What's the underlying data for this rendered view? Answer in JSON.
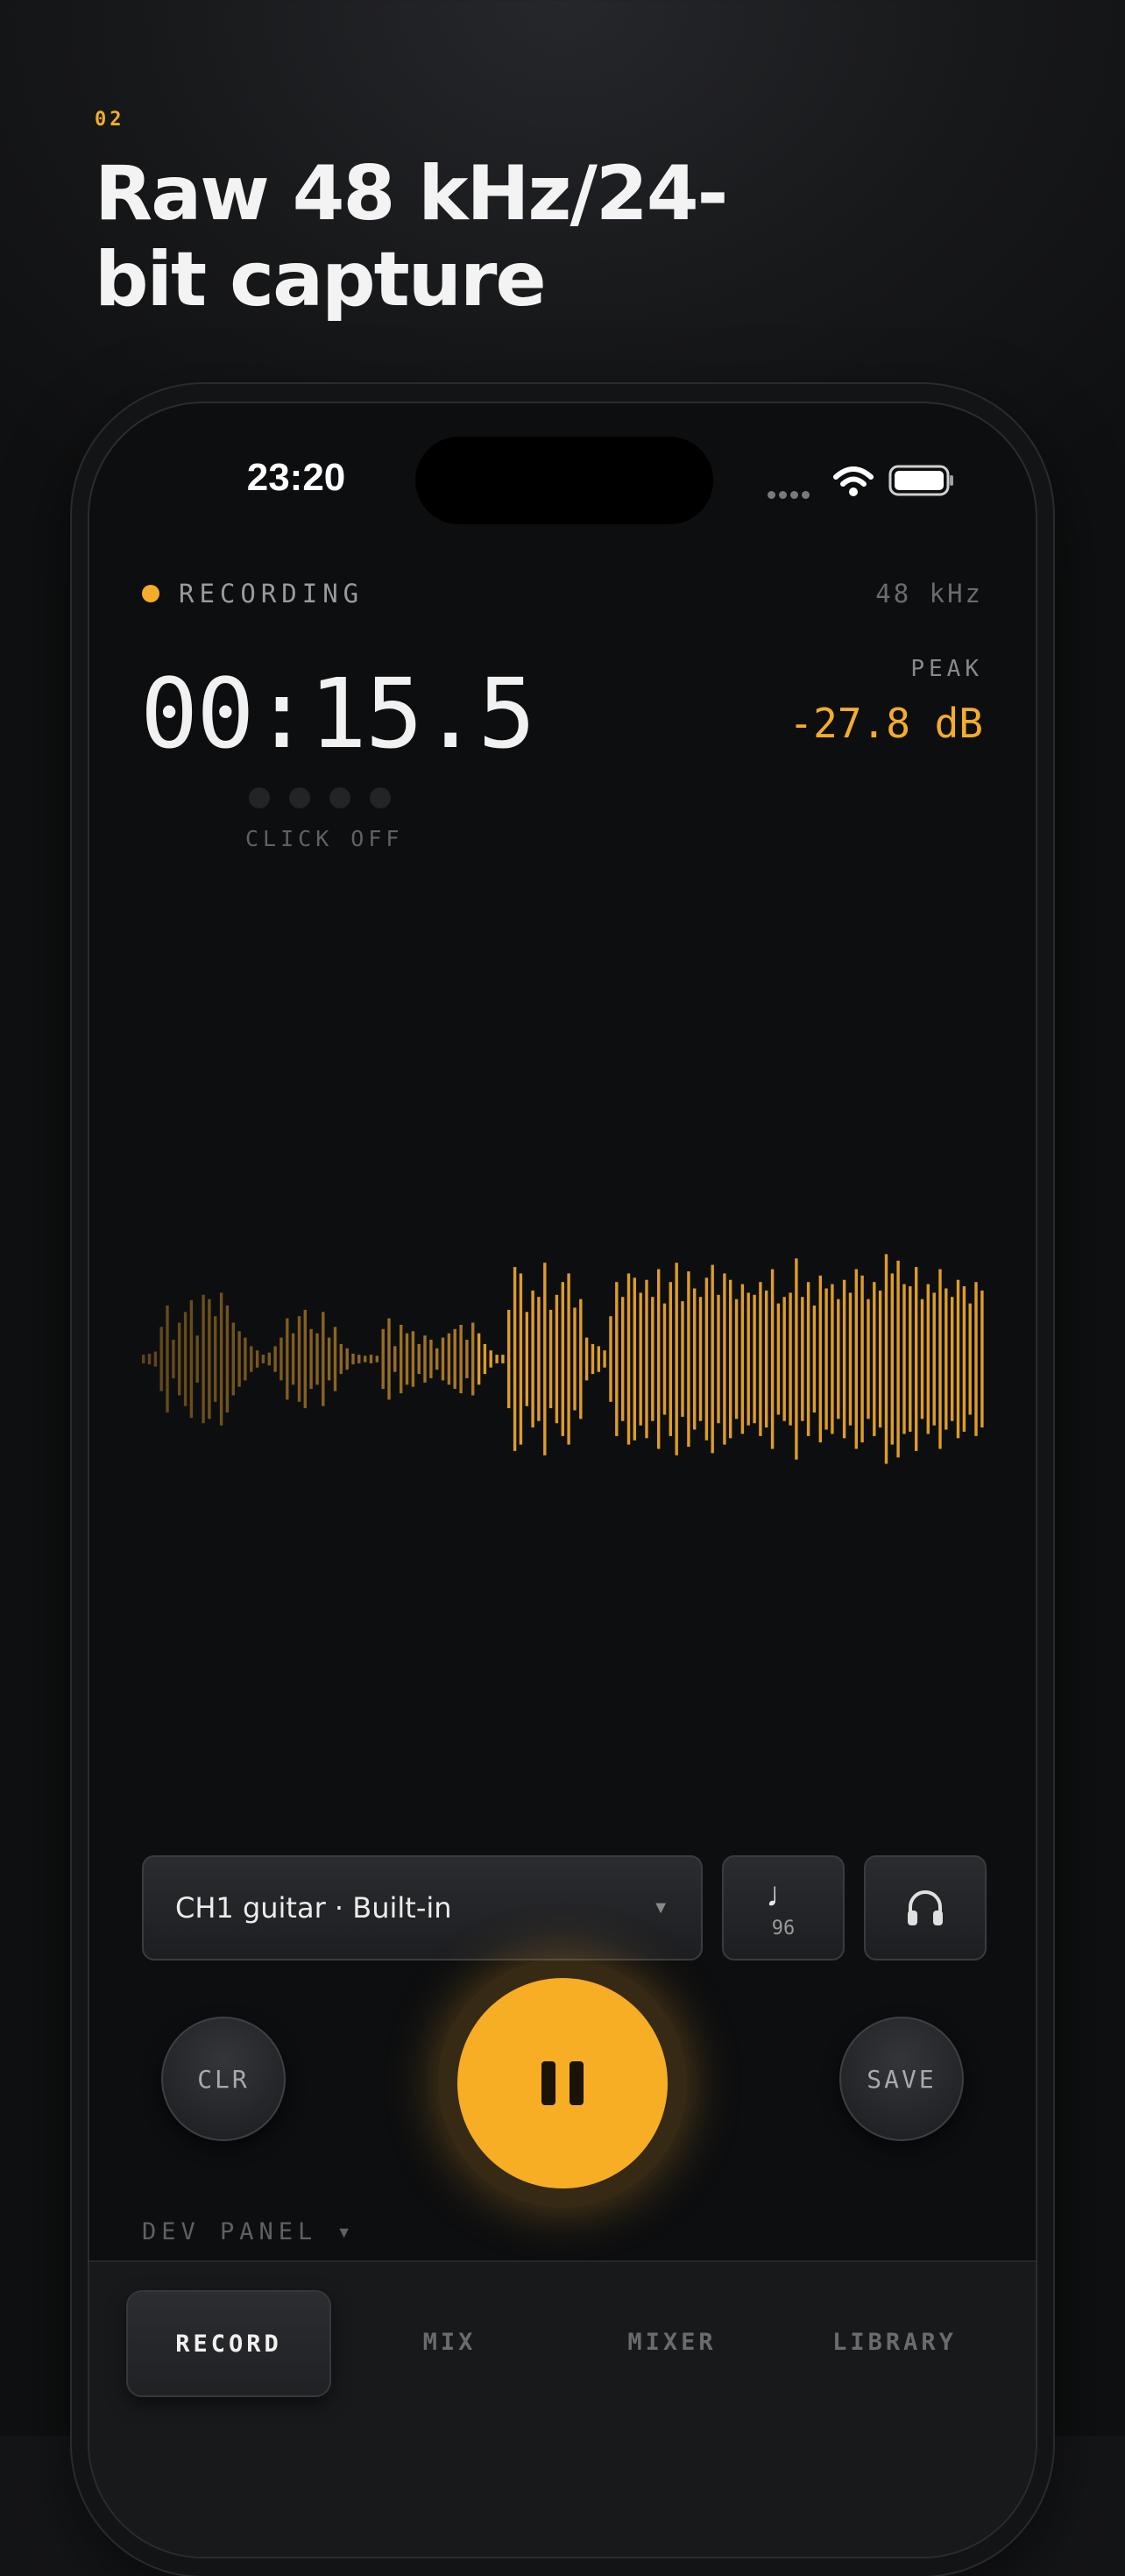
{
  "header": {
    "step": "02",
    "title": "Raw 48 kHz/24-bit capture"
  },
  "status_bar": {
    "time": "23:20"
  },
  "recorder": {
    "state_label": "RECORDING",
    "sample_rate": "48 kHz",
    "elapsed": "00:15.5",
    "peak_label": "PEAK",
    "peak_value": "-27.8 dB",
    "click_label": "CLICK OFF",
    "accent_color": "#f4ad2a",
    "waveform_levels": [
      0.04,
      0.05,
      0.07,
      0.3,
      0.5,
      0.18,
      0.34,
      0.44,
      0.55,
      0.22,
      0.6,
      0.56,
      0.4,
      0.62,
      0.5,
      0.34,
      0.26,
      0.2,
      0.12,
      0.08,
      0.04,
      0.06,
      0.12,
      0.2,
      0.38,
      0.24,
      0.4,
      0.46,
      0.28,
      0.24,
      0.44,
      0.2,
      0.3,
      0.14,
      0.1,
      0.05,
      0.04,
      0.03,
      0.04,
      0.03,
      0.28,
      0.38,
      0.12,
      0.32,
      0.24,
      0.26,
      0.14,
      0.22,
      0.18,
      0.1,
      0.2,
      0.24,
      0.28,
      0.32,
      0.18,
      0.34,
      0.24,
      0.14,
      0.08,
      0.04,
      0.04,
      0.46,
      0.86,
      0.8,
      0.44,
      0.64,
      0.58,
      0.9,
      0.46,
      0.6,
      0.72,
      0.8,
      0.48,
      0.56,
      0.2,
      0.14,
      0.12,
      0.08,
      0.4,
      0.72,
      0.58,
      0.8,
      0.76,
      0.62,
      0.74,
      0.58,
      0.84,
      0.52,
      0.72,
      0.9,
      0.54,
      0.82,
      0.66,
      0.58,
      0.76,
      0.88,
      0.6,
      0.8,
      0.74,
      0.56,
      0.7,
      0.62,
      0.6,
      0.72,
      0.64,
      0.84,
      0.52,
      0.58,
      0.62,
      0.94,
      0.58,
      0.72,
      0.5,
      0.78,
      0.66,
      0.7,
      0.56,
      0.74,
      0.62,
      0.84,
      0.78,
      0.56,
      0.72,
      0.64,
      0.98,
      0.8,
      0.92,
      0.7,
      0.68,
      0.86,
      0.56,
      0.7,
      0.62,
      0.84,
      0.66,
      0.58,
      0.74,
      0.68,
      0.52,
      0.72,
      0.64
    ]
  },
  "controls": {
    "input_label": "CH1 guitar · Built-in",
    "input_caret": "▼",
    "metronome_icon": "♩",
    "metronome_bpm": "96",
    "headphones_icon": "headphones-icon",
    "clear_label": "CLR",
    "save_label": "SAVE",
    "pause_icon": "pause-icon",
    "dev_panel_label": "DEV PANEL ▾"
  },
  "tabs": [
    {
      "label": "RECORD",
      "active": true
    },
    {
      "label": "MIX",
      "active": false
    },
    {
      "label": "MIXER",
      "active": false
    },
    {
      "label": "LIBRARY",
      "active": false
    }
  ]
}
